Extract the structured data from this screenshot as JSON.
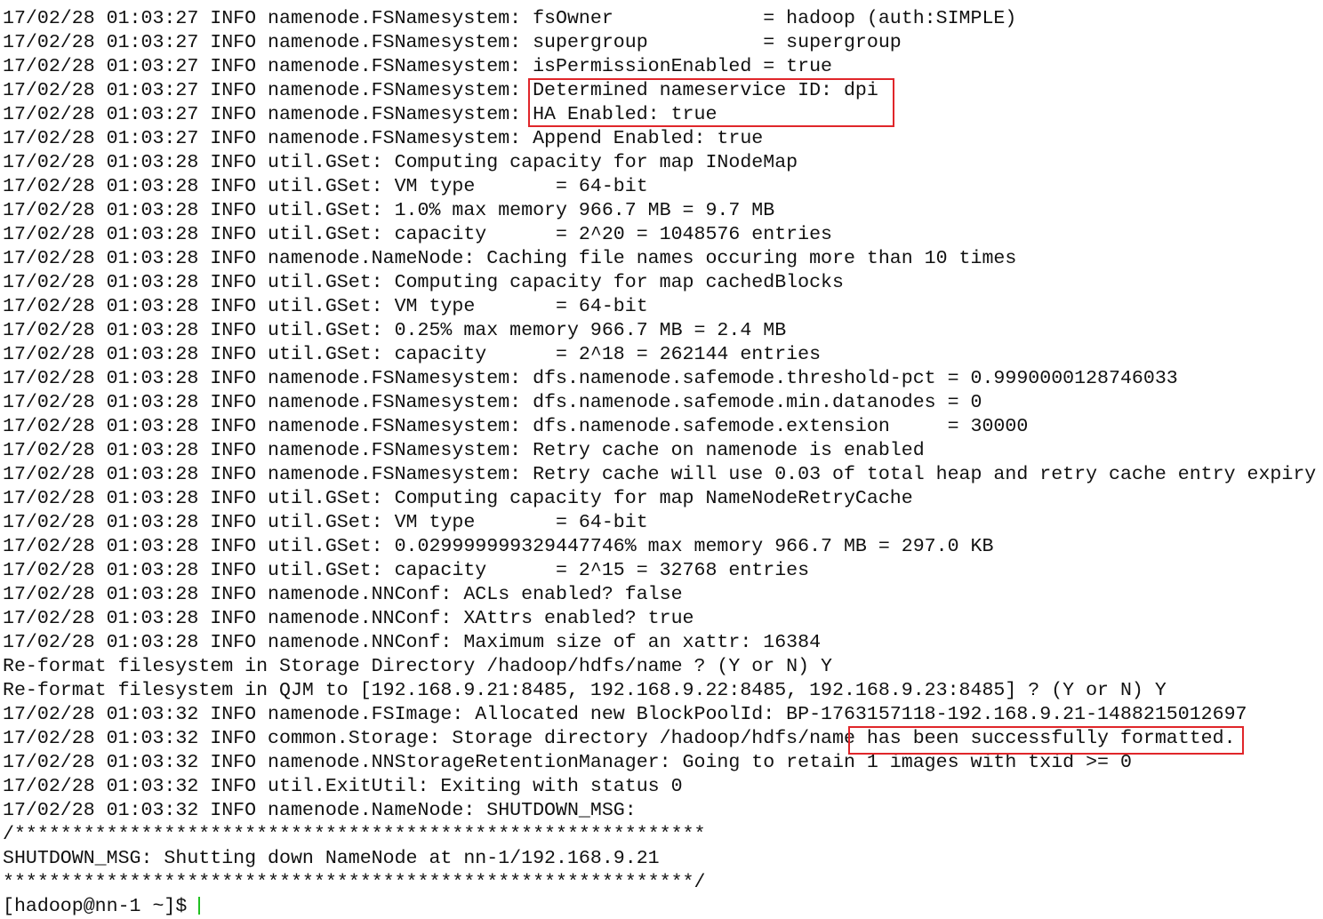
{
  "terminal": {
    "lines": [
      "",
      "17/02/28 01:03:27 INFO namenode.FSNamesystem: fsOwner             = hadoop (auth:SIMPLE)",
      "17/02/28 01:03:27 INFO namenode.FSNamesystem: supergroup          = supergroup",
      "17/02/28 01:03:27 INFO namenode.FSNamesystem: isPermissionEnabled = true",
      "17/02/28 01:03:27 INFO namenode.FSNamesystem: Determined nameservice ID: dpi",
      "17/02/28 01:03:27 INFO namenode.FSNamesystem: HA Enabled: true",
      "17/02/28 01:03:27 INFO namenode.FSNamesystem: Append Enabled: true",
      "17/02/28 01:03:28 INFO util.GSet: Computing capacity for map INodeMap",
      "17/02/28 01:03:28 INFO util.GSet: VM type       = 64-bit",
      "17/02/28 01:03:28 INFO util.GSet: 1.0% max memory 966.7 MB = 9.7 MB",
      "17/02/28 01:03:28 INFO util.GSet: capacity      = 2^20 = 1048576 entries",
      "17/02/28 01:03:28 INFO namenode.NameNode: Caching file names occuring more than 10 times",
      "17/02/28 01:03:28 INFO util.GSet: Computing capacity for map cachedBlocks",
      "17/02/28 01:03:28 INFO util.GSet: VM type       = 64-bit",
      "17/02/28 01:03:28 INFO util.GSet: 0.25% max memory 966.7 MB = 2.4 MB",
      "17/02/28 01:03:28 INFO util.GSet: capacity      = 2^18 = 262144 entries",
      "17/02/28 01:03:28 INFO namenode.FSNamesystem: dfs.namenode.safemode.threshold-pct = 0.9990000128746033",
      "17/02/28 01:03:28 INFO namenode.FSNamesystem: dfs.namenode.safemode.min.datanodes = 0",
      "17/02/28 01:03:28 INFO namenode.FSNamesystem: dfs.namenode.safemode.extension     = 30000",
      "17/02/28 01:03:28 INFO namenode.FSNamesystem: Retry cache on namenode is enabled",
      "17/02/28 01:03:28 INFO namenode.FSNamesystem: Retry cache will use 0.03 of total heap and retry cache entry expiry",
      "17/02/28 01:03:28 INFO util.GSet: Computing capacity for map NameNodeRetryCache",
      "17/02/28 01:03:28 INFO util.GSet: VM type       = 64-bit",
      "17/02/28 01:03:28 INFO util.GSet: 0.029999999329447746% max memory 966.7 MB = 297.0 KB",
      "17/02/28 01:03:28 INFO util.GSet: capacity      = 2^15 = 32768 entries",
      "17/02/28 01:03:28 INFO namenode.NNConf: ACLs enabled? false",
      "17/02/28 01:03:28 INFO namenode.NNConf: XAttrs enabled? true",
      "17/02/28 01:03:28 INFO namenode.NNConf: Maximum size of an xattr: 16384",
      "Re-format filesystem in Storage Directory /hadoop/hdfs/name ? (Y or N) Y",
      "Re-format filesystem in QJM to [192.168.9.21:8485, 192.168.9.22:8485, 192.168.9.23:8485] ? (Y or N) Y",
      "17/02/28 01:03:32 INFO namenode.FSImage: Allocated new BlockPoolId: BP-1763157118-192.168.9.21-1488215012697",
      "17/02/28 01:03:32 INFO common.Storage: Storage directory /hadoop/hdfs/name has been successfully formatted.",
      "17/02/28 01:03:32 INFO namenode.NNStorageRetentionManager: Going to retain 1 images with txid >= 0",
      "17/02/28 01:03:32 INFO util.ExitUtil: Exiting with status 0",
      "17/02/28 01:03:32 INFO namenode.NameNode: SHUTDOWN_MSG:",
      "/************************************************************",
      "SHUTDOWN_MSG: Shutting down NameNode at nn-1/192.168.9.21",
      "************************************************************/"
    ],
    "prompt": "[hadoop@nn-1 ~]$ "
  },
  "colors": {
    "highlight_box": "#e0262a",
    "cursor": "#22c022"
  }
}
